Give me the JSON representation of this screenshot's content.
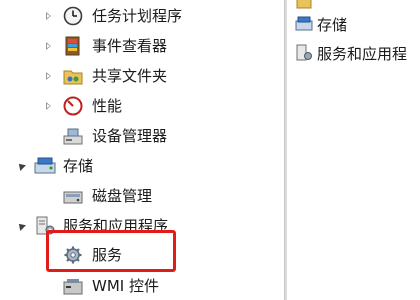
{
  "tree": {
    "items": [
      {
        "label": "任务计划程序",
        "icon": "clock-icon",
        "state": "collapsed"
      },
      {
        "label": "事件查看器",
        "icon": "event-viewer-icon",
        "state": "collapsed"
      },
      {
        "label": "共享文件夹",
        "icon": "shared-folder-icon",
        "state": "collapsed"
      },
      {
        "label": "性能",
        "icon": "performance-icon",
        "state": "collapsed"
      },
      {
        "label": "设备管理器",
        "icon": "device-manager-icon",
        "state": "none"
      },
      {
        "label": "存储",
        "icon": "storage-icon",
        "state": "expanded"
      },
      {
        "label": "磁盘管理",
        "icon": "disk-management-icon",
        "state": "none"
      },
      {
        "label": "服务和应用程序",
        "icon": "services-apps-icon",
        "state": "expanded"
      },
      {
        "label": "服务",
        "icon": "services-gear-icon",
        "state": "none",
        "selected": true
      },
      {
        "label": "WMI 控件",
        "icon": "wmi-control-icon",
        "state": "none"
      }
    ]
  },
  "right_list": {
    "items": [
      {
        "label": "存储",
        "icon": "storage-icon"
      },
      {
        "label": "服务和应用程",
        "icon": "services-apps-icon"
      }
    ]
  },
  "colors": {
    "highlight": "#e11a1a"
  }
}
